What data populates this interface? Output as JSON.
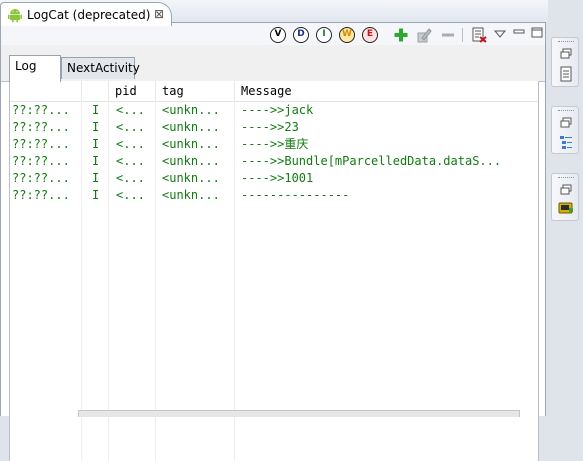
{
  "view": {
    "title": "LogCat (deprecated)",
    "close_glyph": "⊠"
  },
  "toolbar": {
    "levels": [
      {
        "letter": "V",
        "color": "#000000"
      },
      {
        "letter": "D",
        "color": "#1a2a8c"
      },
      {
        "letter": "I",
        "color": "#0b8a16"
      },
      {
        "letter": "W",
        "color": "#d98a00"
      },
      {
        "letter": "E",
        "color": "#c8141e"
      }
    ],
    "icons": [
      "add-filter-icon",
      "edit-filter-icon",
      "remove-filter-icon",
      "clear-log-icon",
      "view-menu-icon",
      "minimize-icon",
      "maximize-icon"
    ]
  },
  "subtabs": [
    "Log",
    "NextActivity"
  ],
  "table": {
    "columns": [
      "",
      "",
      "pid",
      "tag",
      "Message"
    ],
    "rows": [
      {
        "time": "??:??...",
        "level": "I",
        "pid": "<...",
        "tag": "<unkn...",
        "message": "---->>jack"
      },
      {
        "time": "??:??...",
        "level": "I",
        "pid": "<...",
        "tag": "<unkn...",
        "message": "---->>23"
      },
      {
        "time": "??:??...",
        "level": "I",
        "pid": "<...",
        "tag": "<unkn...",
        "message": "---->>重庆"
      },
      {
        "time": "??:??...",
        "level": "I",
        "pid": "<...",
        "tag": "<unkn...",
        "message": "---->>Bundle[mParcelledData.dataS..."
      },
      {
        "time": "??:??...",
        "level": "I",
        "pid": "<...",
        "tag": "<unkn...",
        "message": "---->>1001"
      },
      {
        "time": "??:??...",
        "level": "I",
        "pid": "<...",
        "tag": "<unkn...",
        "message": "---------------"
      }
    ]
  },
  "trim": {
    "groups": [
      {
        "icons": [
          "restore-icon",
          "document-icon"
        ]
      },
      {
        "icons": [
          "restore-icon",
          "outline-icon"
        ]
      },
      {
        "icons": [
          "restore-icon",
          "console-icon"
        ]
      }
    ]
  },
  "colors": {
    "log_text": "#127b12",
    "frame": "#9aa6b6"
  }
}
